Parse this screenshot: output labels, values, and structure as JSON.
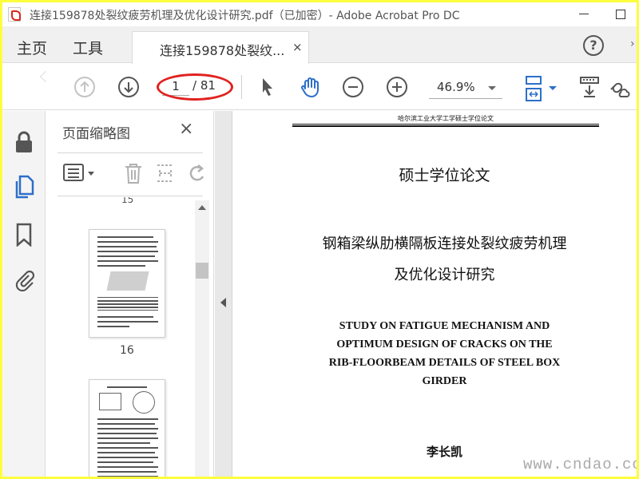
{
  "window": {
    "title": "连接159878处裂纹疲劳机理及优化设计研究.pdf（已加密）- Adobe Acrobat Pro DC"
  },
  "tabs": {
    "home": "主页",
    "tools": "工具",
    "document": "连接159878处裂纹...",
    "close": "×",
    "help": "?"
  },
  "toolbar": {
    "current_page": "1",
    "total_pages": "/ 81",
    "zoom": "46.9%"
  },
  "panel": {
    "title": "页面缩略图",
    "close": "×",
    "partial_label": "15",
    "thumb_label": "16"
  },
  "document": {
    "header": "哈尔滨工业大学工学硕士学位论文",
    "degree": "硕士学位论文",
    "title_cn_line1": "钢箱梁纵肋横隔板连接处裂纹疲劳机理",
    "title_cn_line2": "及优化设计研究",
    "title_en_line1": "STUDY ON FATIGUE MECHANISM AND",
    "title_en_line2": "OPTIMUM DESIGN OF CRACKS ON THE",
    "title_en_line3": "RIB-FLOORBEAM DETAILS OF STEEL BOX",
    "title_en_line4": "GIRDER",
    "author": "李长凯"
  },
  "watermark": "www.cndao.com",
  "colors": {
    "highlight_ellipse": "#e0221f",
    "accent_blue": "#2d6fc9",
    "screenshot_border": "#fdfd3f"
  },
  "icons": {
    "app": "acrobat-icon",
    "lock": "lock-icon",
    "pages": "pages-icon",
    "bookmark": "bookmark-icon",
    "attachment": "paperclip-icon"
  }
}
